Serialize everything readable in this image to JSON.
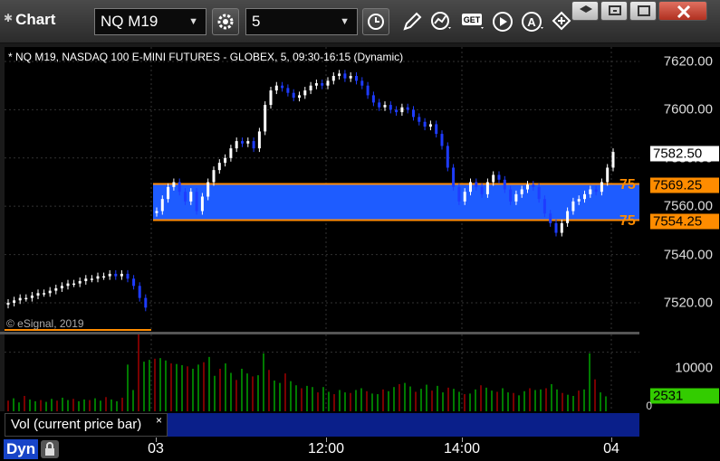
{
  "window": {
    "title": "Chart",
    "symbol_value": "NQ M19",
    "interval_value": "5"
  },
  "toolbar_icons": [
    "settings-gear-icon",
    "clock-icon",
    "pencil-icon",
    "study-icon",
    "get-icon",
    "play-icon",
    "alert-icon",
    "cursor-icon"
  ],
  "window_buttons": [
    "help-icon",
    "restore-icon",
    "maximize-icon",
    "close-icon"
  ],
  "chart": {
    "label": "* NQ M19, NASDAQ 100 E-MINI FUTURES - GLOBEX, 5, 09:30-16:15 (Dynamic)",
    "copyright": "© eSignal, 2019",
    "current_price_tag": "7582.50",
    "level_upper_tag": "7569.25",
    "level_lower_tag": "7554.25",
    "level_upper_label": "75",
    "level_lower_label": "75",
    "volume_tag": "2531",
    "volume_tick_top": "10000",
    "volume_tick_bottom": "0",
    "volume_legend": "Vol (current price bar)",
    "close_glyph": "×",
    "dyn_label": "Dyn",
    "time_labels": [
      "03",
      "12:00",
      "14:00",
      "04"
    ]
  },
  "colors": {
    "up": "#ffffff",
    "down": "#1e3cff",
    "zone": "#1e5cff",
    "level": "#ff8c00",
    "vol_up": "#00cc00",
    "vol_down": "#cc0000",
    "volume_tag_bg": "#33cc00"
  },
  "chart_data": {
    "type": "candlestick",
    "price_axis": {
      "ticks": [
        7620,
        7600,
        7580,
        7560,
        7540,
        7520
      ],
      "range": [
        7508,
        7626
      ]
    },
    "volume_axis": {
      "ticks": [
        10000,
        0
      ],
      "range": [
        0,
        13000
      ]
    },
    "levels": [
      7569.25,
      7554.25
    ],
    "last_price": 7582.5,
    "last_volume": 2531,
    "prev_session_closes": [
      7520,
      7521,
      7522,
      7522,
      7523,
      7524,
      7524,
      7525,
      7526,
      7527,
      7528,
      7528,
      7529,
      7530,
      7530,
      7531,
      7531,
      7532,
      7531,
      7532,
      7530,
      7527,
      7522,
      7518
    ],
    "session_closes": [
      7558,
      7563,
      7568,
      7570,
      7566,
      7562,
      7566,
      7558,
      7564,
      7570,
      7575,
      7578,
      7580,
      7584,
      7587,
      7586,
      7587,
      7584,
      7591,
      7602,
      7608,
      7610,
      7609,
      7607,
      7605,
      7606,
      7608,
      7610,
      7611,
      7610,
      7612,
      7614,
      7615,
      7613,
      7614,
      7612,
      7610,
      7606,
      7603,
      7601,
      7602,
      7600,
      7599,
      7601,
      7600,
      7597,
      7595,
      7593,
      7594,
      7590,
      7585,
      7576,
      7568,
      7562,
      7566,
      7570,
      7568,
      7565,
      7570,
      7573,
      7571,
      7567,
      7562,
      7565,
      7567,
      7569,
      7568,
      7563,
      7557,
      7553,
      7549,
      7553,
      7558,
      7562,
      7563,
      7565,
      7567,
      7566,
      7570,
      7576,
      7582.5
    ],
    "volumes": [
      1800,
      2200,
      1500,
      2600,
      2000,
      1700,
      1900,
      1600,
      2100,
      1800,
      2300,
      1900,
      2100,
      1700,
      2000,
      1900,
      2200,
      1800,
      2400,
      2000,
      1700,
      2300,
      7900,
      3600,
      13000,
      8400,
      8700,
      8900,
      9000,
      8600,
      8100,
      8000,
      7800,
      7600,
      7200,
      7900,
      8300,
      9200,
      6000,
      7200,
      8100,
      6500,
      5300,
      7200,
      6400,
      5900,
      6100,
      9800,
      7000,
      5200,
      4800,
      6400,
      5100,
      4400,
      3900,
      4300,
      4100,
      3200,
      4100,
      3300,
      2900,
      3600,
      3200,
      3100,
      3600,
      3900,
      3400,
      3000,
      2900,
      3700,
      3400,
      4100,
      4600,
      4800,
      4200,
      3300,
      3800,
      4500,
      3500,
      4300,
      3200,
      4000,
      3800,
      3300,
      2900,
      3000,
      3700,
      4400,
      4000,
      3500,
      3300,
      3900,
      3200,
      3100,
      2700,
      3400,
      3900,
      3600,
      3700,
      3900,
      4600,
      3700,
      3100,
      2800,
      2600,
      3500,
      3700,
      9800,
      5400,
      3200,
      2531
    ]
  }
}
